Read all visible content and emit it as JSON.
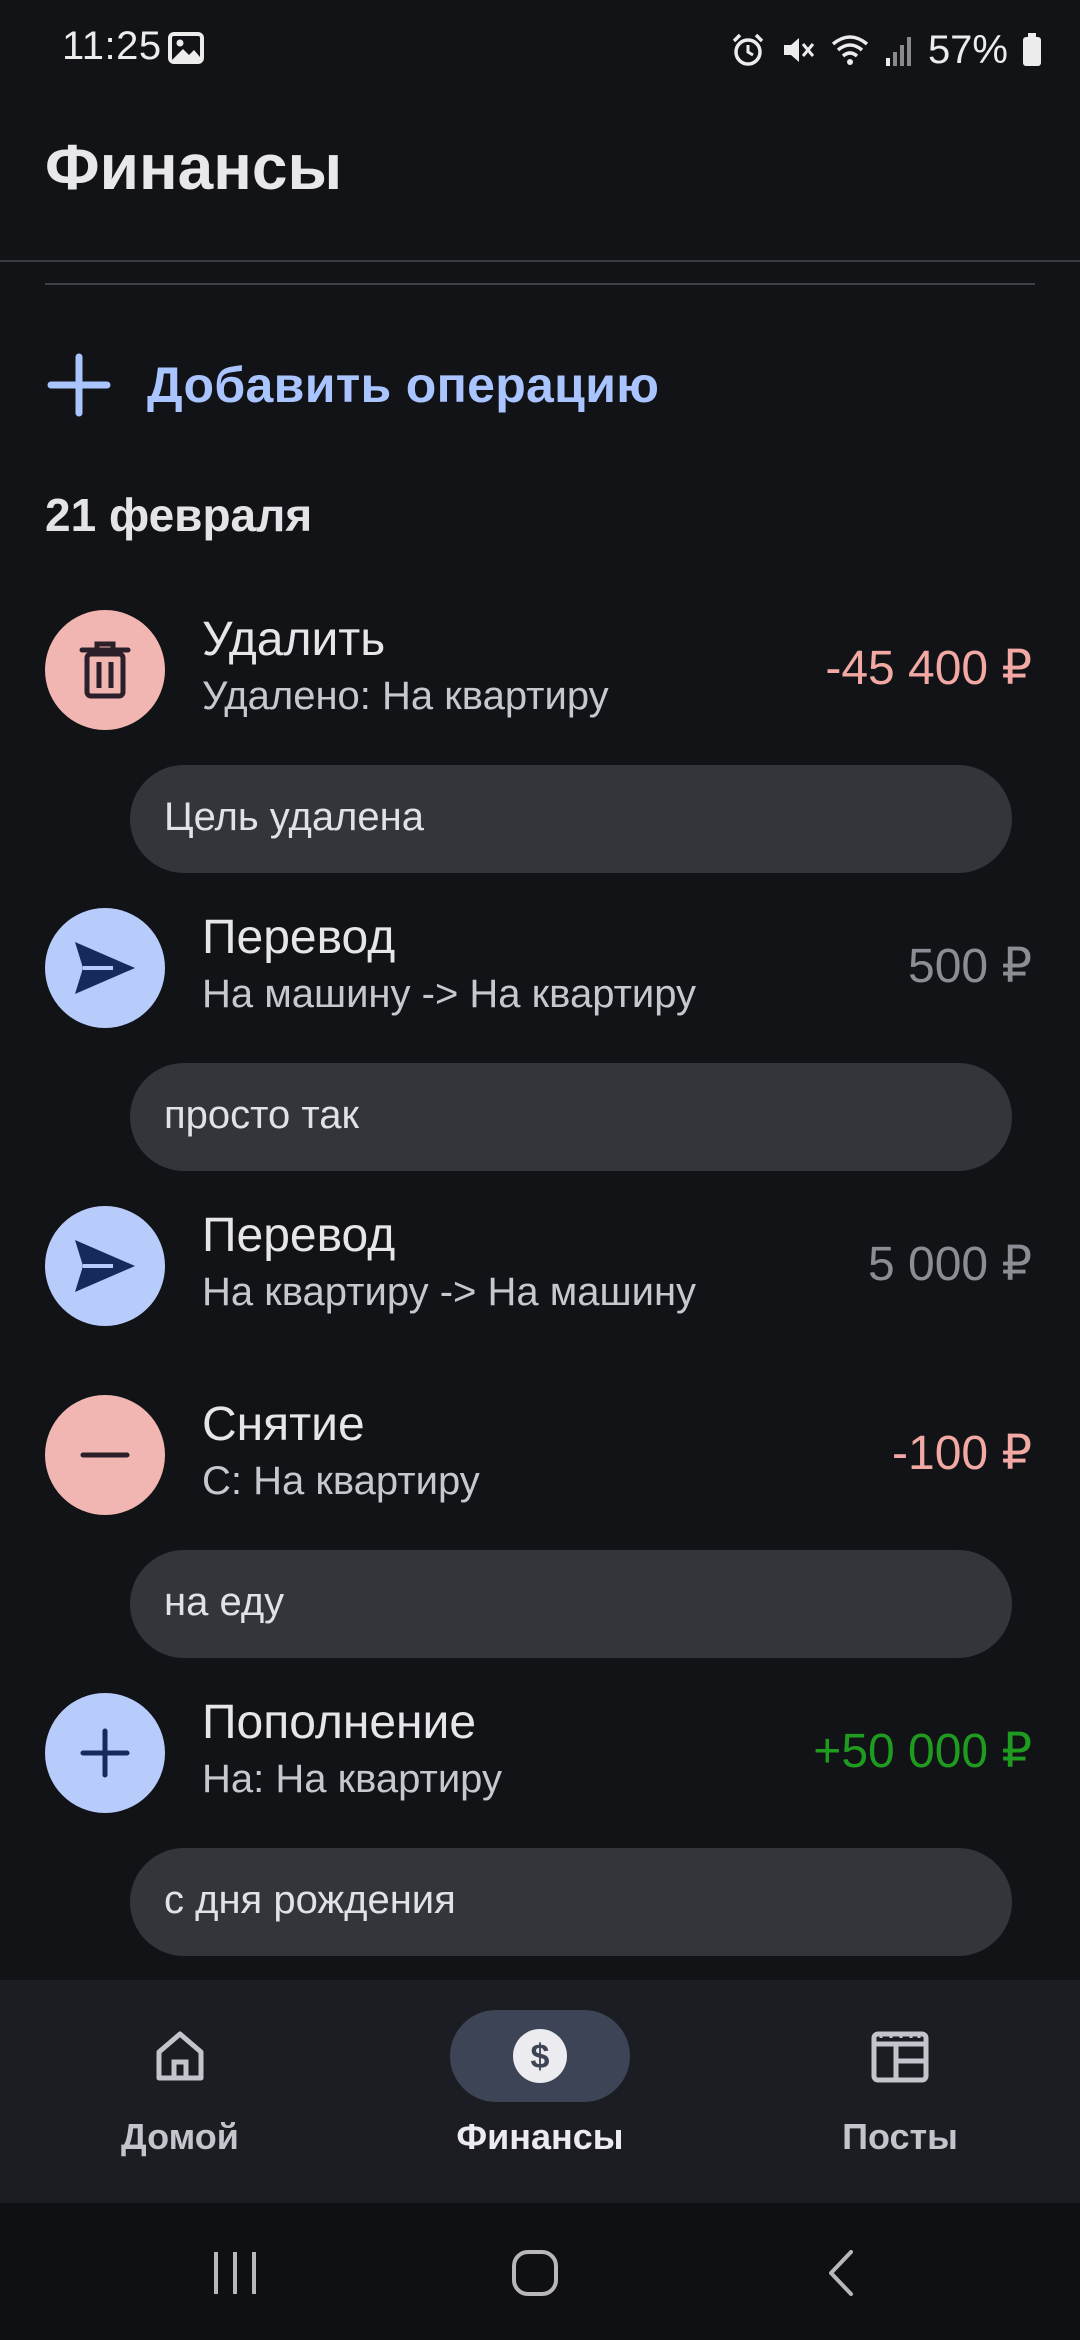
{
  "status_bar": {
    "time": "11:25",
    "battery": "57%"
  },
  "header": {
    "title": "Финансы"
  },
  "add_operation": {
    "label": "Добавить операцию"
  },
  "date_group": "21 февраля",
  "operations": [
    {
      "title": "Удалить",
      "subtitle": "Удалено: На квартиру",
      "amount": "-45 400 ₽",
      "note": "Цель удалена",
      "icon": "trash-icon"
    },
    {
      "title": "Перевод",
      "subtitle": "На машину -> На квартиру",
      "amount": "500 ₽",
      "note": "просто так",
      "icon": "send-icon"
    },
    {
      "title": "Перевод",
      "subtitle": "На квартиру -> На машину",
      "amount": "5 000 ₽",
      "note": "",
      "icon": "send-icon"
    },
    {
      "title": "Снятие",
      "subtitle": "С: На квартиру",
      "amount": "-100 ₽",
      "note": "на еду",
      "icon": "minus-icon"
    },
    {
      "title": "Пополнение",
      "subtitle": "На: На квартиру",
      "amount": "+50 000 ₽",
      "note": "с дня рождения",
      "icon": "plus-icon"
    }
  ],
  "colors": {
    "accent": "#a9c4ff",
    "expense_icon_bg": "#f2b6b2",
    "transfer_icon_bg": "#b8ccfb",
    "amount_negative": "#f2a9a3",
    "amount_neutral": "#8c8d94",
    "amount_positive": "#1f9c1f"
  },
  "bottom_nav": {
    "items": [
      {
        "label": "Домой",
        "icon": "home-icon"
      },
      {
        "label": "Финансы",
        "icon": "dollar-icon",
        "active": true
      },
      {
        "label": "Посты",
        "icon": "newspaper-icon"
      }
    ]
  }
}
